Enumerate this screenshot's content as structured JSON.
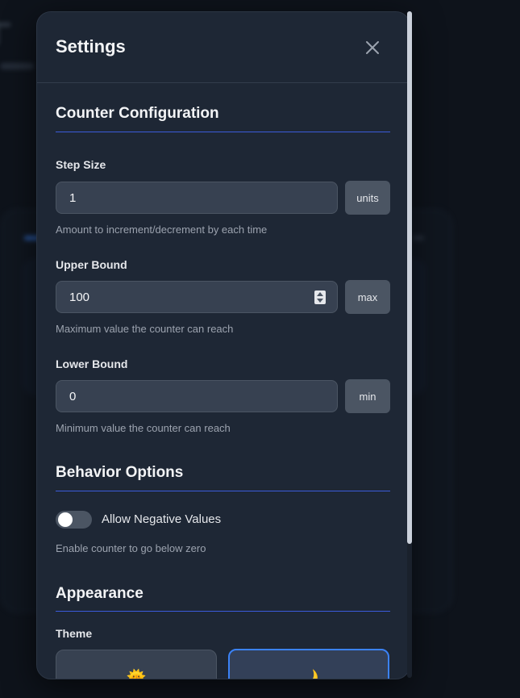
{
  "modal": {
    "title": "Settings",
    "close_icon": "close-icon"
  },
  "counter_configuration": {
    "title": "Counter Configuration",
    "step_size": {
      "label": "Step Size",
      "value": "1",
      "unit": "units",
      "help": "Amount to increment/decrement by each time"
    },
    "upper_bound": {
      "label": "Upper Bound",
      "value": "100",
      "unit": "max",
      "help": "Maximum value the counter can reach"
    },
    "lower_bound": {
      "label": "Lower Bound",
      "value": "0",
      "unit": "min",
      "help": "Minimum value the counter can reach"
    }
  },
  "behavior_options": {
    "title": "Behavior Options",
    "allow_negative": {
      "label": "Allow Negative Values",
      "enabled": false,
      "help": "Enable counter to go below zero"
    }
  },
  "appearance": {
    "title": "Appearance",
    "theme_label": "Theme",
    "themes": [
      {
        "icon": "sun-icon",
        "glyph": "🌞",
        "selected": false
      },
      {
        "icon": "moon-icon",
        "glyph": "🌙",
        "selected": true
      }
    ]
  },
  "colors": {
    "accent": "#3b82f6",
    "modal_bg": "#1e2735",
    "input_bg": "#374151"
  }
}
